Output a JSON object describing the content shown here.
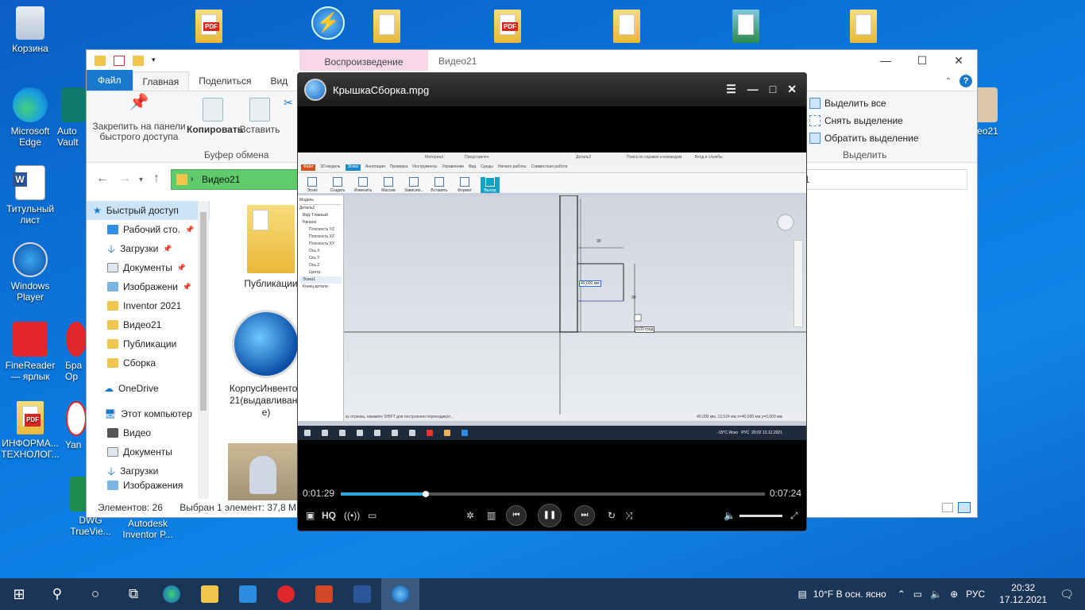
{
  "desktop_icons": [
    {
      "label": "Корзина"
    },
    {
      "label": "Microsoft Edge"
    },
    {
      "label": "Auto Vault"
    },
    {
      "label": "Титульный лист"
    },
    {
      "label": "Windows Player"
    },
    {
      "label": "FineReader — ярлык"
    },
    {
      "label": "Бра Ор"
    },
    {
      "label": "ИНФОРМА... ТЕХНОЛОГ..."
    },
    {
      "label": "Yan"
    },
    {
      "label": "DWG TrueVie..."
    },
    {
      "label": "Autodesk Inventor P..."
    },
    {
      "label": "део21"
    }
  ],
  "explorer": {
    "context_tab": "Воспроизведение",
    "window_title": "Видео21",
    "tabs": [
      "Файл",
      "Главная",
      "Поделиться",
      "Вид"
    ],
    "ribbon": {
      "pin_label": "Закрепить на панели быстрого доступа",
      "copy_label": "Копировать",
      "paste_label": "Вставить",
      "clipboard_group": "Буфер обмена",
      "select_all": "Выделить все",
      "deselect": "Снять выделение",
      "invert": "Обратить выделение",
      "select_group": "Выделить"
    },
    "address": "Видео21",
    "search_partial": "1",
    "nav": {
      "quick_access": "Быстрый доступ",
      "items": [
        "Рабочий сто.",
        "Загрузки",
        "Документы",
        "Изображени",
        "Inventor 2021",
        "Видео21",
        "Публикации",
        "Сборка"
      ],
      "onedrive": "OneDrive",
      "this_pc": "Этот компьютер",
      "pc_items": [
        "Видео",
        "Документы",
        "Загрузки",
        "Изображения"
      ]
    },
    "files": [
      {
        "name": "Публикации"
      },
      {
        "name": "КорпусИнвентор21(выдавливание)"
      }
    ],
    "status": {
      "count": "Элементов: 26",
      "selected": "Выбран 1 элемент: 37,8 МБ"
    }
  },
  "player": {
    "title": "КрышкаСборка.mpg",
    "current_time": "0:01:29",
    "total_time": "0:07:24",
    "progress_fraction": 0.2,
    "quality_label": "HQ",
    "inventor": {
      "doc_title": "Деталь2",
      "search_hint": "Поиск по справке и командам",
      "login": "Вход в службы",
      "material": "Материал",
      "appearance": "Представлен",
      "tabs": [
        "Файл",
        "3D-модель",
        "Эскиз",
        "Аннотация",
        "Проверка",
        "Инструменты",
        "Управление",
        "Вид",
        "Среды",
        "Начало работы",
        "Совместная работа"
      ],
      "tools": [
        "Эскиз",
        "Создать",
        "Изменить",
        "Массив",
        "Зависим...",
        "Вставить",
        "Формат",
        "Выход"
      ],
      "browser_title": "Модель",
      "browser_items": [
        "Деталь2",
        "Вид: Главный",
        "Начало",
        "Плоскость YZ",
        "Плоскость XZ",
        "Плоскость XY",
        "Ось X",
        "Ось Y",
        "Ось Z",
        "Центр",
        "Эскиз1",
        "Конец детали"
      ],
      "dim_30_top": "30",
      "dim_30_side": "30",
      "input_value": "40,000 мм",
      "angle_value": "0,00 град",
      "status_hint": "ку отрезка, нажмите SHIFT для построения перпендикул...",
      "coords": "40,000 мм, 13,524 мм   x=40,000 мм   y=0,000 мм",
      "inner_tray": "-15°C Ясно",
      "inner_lang": "РУС",
      "inner_time": "20:02",
      "inner_date": "13.12.2021"
    }
  },
  "taskbar": {
    "weather": "10°F  В осн. ясно",
    "lang": "РУС",
    "time": "20:32",
    "date": "17.12.2021"
  },
  "colors": {
    "desktop": "#0b74d8",
    "taskbar": "#1b3557",
    "accent": "#1979ca",
    "seek_fill": "#29a8e0"
  }
}
